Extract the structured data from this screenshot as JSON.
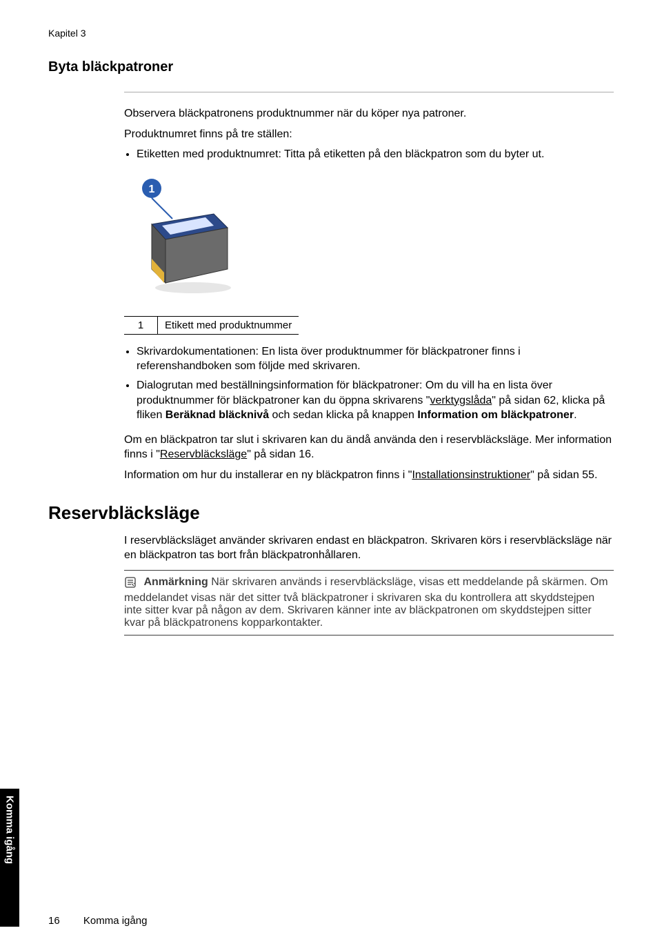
{
  "chapter_label": "Kapitel 3",
  "heading1": "Byta bläckpatroner",
  "intro_p1": "Observera bläckpatronens produktnummer när du köper nya patroner.",
  "intro_p2": "Produktnumret finns på tre ställen:",
  "first_bullet": "Etiketten med produktnumret: Titta på etiketten på den bläckpatron som du byter ut.",
  "callout_number": "1",
  "legend_num": "1",
  "legend_text": "Etikett med produktnummer",
  "second_bullets": {
    "b1": "Skrivardokumentationen: En lista över produktnummer för bläckpatroner finns i referenshandboken som följde med skrivaren.",
    "b2_pre": "Dialogrutan med beställningsinformation för bläckpatroner: Om du vill ha en lista över produktnummer för bläckpatroner kan du öppna skrivarens \"",
    "b2_link1": "verktygslåda",
    "b2_mid1": "\" på sidan 62, klicka på fliken ",
    "b2_bold1": "Beräknad bläcknivå",
    "b2_mid2": " och sedan klicka på knappen ",
    "b2_bold2": "Information om bläckpatroner",
    "b2_end": "."
  },
  "para_reserve": {
    "pre": "Om en bläckpatron tar slut i skrivaren kan du ändå använda den i reservbläcksläge. Mer information finns i \"",
    "link": "Reservbläcksläge",
    "post": "\" på sidan 16."
  },
  "para_install": {
    "pre": "Information om hur du installerar en ny bläckpatron finns i \"",
    "link": "Installationsinstruktioner",
    "post": "\" på sidan 55."
  },
  "heading2": "Reservbläcksläge",
  "reserve_p1": "I reservbläcksläget använder skrivaren endast en bläckpatron. Skrivaren körs i reservbläcksläge när en bläckpatron tas bort från bläckpatronhållaren.",
  "note": {
    "lead": "Anmärkning",
    "text": " När skrivaren används i reservbläcksläge, visas ett meddelande på skärmen. Om meddelandet visas när det sitter två bläckpatroner i skrivaren ska du kontrollera att skyddstejpen inte sitter kvar på någon av dem. Skrivaren känner inte av bläckpatronen om skyddstejpen sitter kvar på bläckpatronens kopparkontakter."
  },
  "side_tab": "Komma igång",
  "footer_page": "16",
  "footer_section": "Komma igång"
}
